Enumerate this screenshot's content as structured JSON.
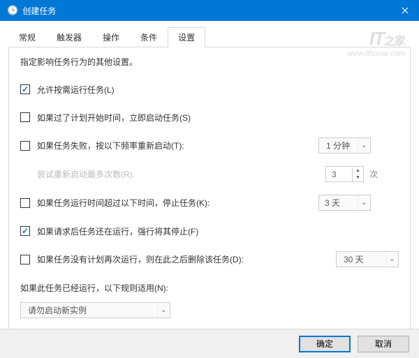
{
  "title": "创建任务",
  "watermark": {
    "logo_main": "IT",
    "logo_sub": "之家",
    "url": "www.ithome.com"
  },
  "tabs": [
    "常规",
    "触发器",
    "操作",
    "条件",
    "设置"
  ],
  "active_tab": "设置",
  "desc": "指定影响任务行为的其他设置。",
  "settings": {
    "allow_on_demand": {
      "checked": true,
      "label": "允许按需运行任务(L)"
    },
    "run_asap": {
      "checked": false,
      "label": "如果过了计划开始时间，立即启动任务(S)"
    },
    "restart_fail": {
      "checked": false,
      "label": "如果任务失败，按以下频率重新启动(T):",
      "value": "1 分钟"
    },
    "restart_attempts": {
      "label": "尝试重新启动最多次数(R):",
      "value": "3",
      "suffix": "次"
    },
    "stop_if_long": {
      "checked": false,
      "label": "如果任务运行时间超过以下时间，停止任务(K):",
      "value": "3 天"
    },
    "force_stop": {
      "checked": true,
      "label": "如果请求后任务还在运行，强行将其停止(F)"
    },
    "delete_if_not": {
      "checked": false,
      "label": "如果任务没有计划再次运行，则在此之后删除该任务(D):",
      "value": "30 天"
    },
    "already_running": {
      "label": "如果此任务已经运行，以下规则适用(N):",
      "value": "请勿启动新实例"
    }
  },
  "buttons": {
    "ok": "确定",
    "cancel": "取消"
  }
}
